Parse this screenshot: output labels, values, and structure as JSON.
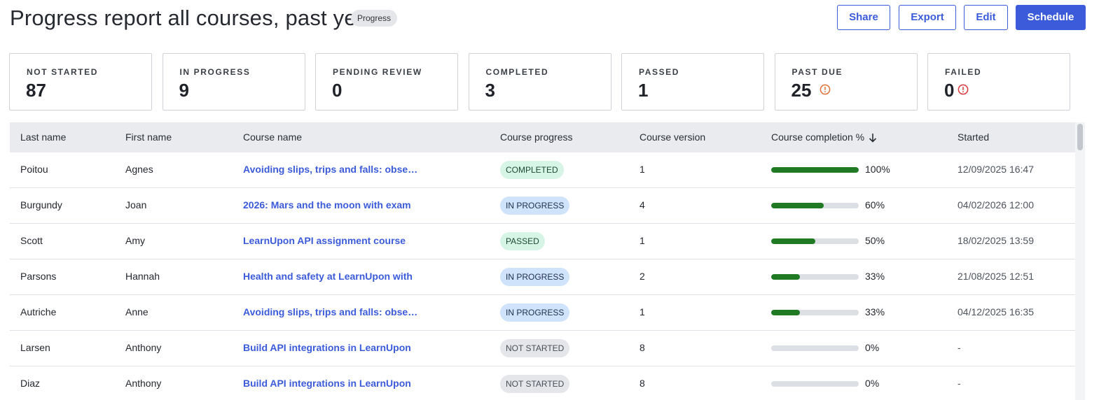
{
  "header": {
    "title": "Progress report all courses, past year",
    "report_type": "Progress",
    "actions": {
      "share": "Share",
      "export": "Export",
      "edit": "Edit",
      "schedule": "Schedule"
    }
  },
  "colors": {
    "accent": "#3b5bdb",
    "progress_fill": "#1f7a23",
    "warning": "#e0703a",
    "danger": "#d9363e"
  },
  "stats": [
    {
      "label": "NOT STARTED",
      "value": "87"
    },
    {
      "label": "IN PROGRESS",
      "value": "9"
    },
    {
      "label": "PENDING REVIEW",
      "value": "0"
    },
    {
      "label": "COMPLETED",
      "value": "3"
    },
    {
      "label": "PASSED",
      "value": "1"
    },
    {
      "label": "PAST DUE",
      "value": "25",
      "icon": "warning-circle-icon"
    },
    {
      "label": "FAILED",
      "value": "0",
      "icon": "error-circle-icon"
    }
  ],
  "table": {
    "columns": [
      "Last name",
      "First name",
      "Course name",
      "Course progress",
      "Course version",
      "Course completion %",
      "Started"
    ],
    "sort": {
      "column": "Course completion %",
      "direction": "descending",
      "icon": "arrow-down-icon"
    },
    "rows": [
      {
        "last": "Poitou",
        "first": "Agnes",
        "course": "Avoiding slips, trips and falls: observe",
        "status": "COMPLETED",
        "status_key": "completed",
        "version": "1",
        "completion": 100,
        "completion_label": "100%",
        "started": "12/09/2025 16:47"
      },
      {
        "last": "Burgundy",
        "first": "Joan",
        "course": "2026: Mars and the moon with exam",
        "status": "IN PROGRESS",
        "status_key": "in-progress",
        "version": "4",
        "completion": 60,
        "completion_label": "60%",
        "started": "04/02/2026 12:00"
      },
      {
        "last": "Scott",
        "first": "Amy",
        "course": "LearnUpon API assignment course",
        "status": "PASSED",
        "status_key": "passed",
        "version": "1",
        "completion": 50,
        "completion_label": "50%",
        "started": "18/02/2025 13:59"
      },
      {
        "last": "Parsons",
        "first": "Hannah",
        "course": "Health and safety at LearnUpon with",
        "status": "IN PROGRESS",
        "status_key": "in-progress",
        "version": "2",
        "completion": 33,
        "completion_label": "33%",
        "started": "21/08/2025 12:51"
      },
      {
        "last": "Autriche",
        "first": "Anne",
        "course": "Avoiding slips, trips and falls: observe",
        "status": "IN PROGRESS",
        "status_key": "in-progress",
        "version": "1",
        "completion": 33,
        "completion_label": "33%",
        "started": "04/12/2025 16:35"
      },
      {
        "last": "Larsen",
        "first": "Anthony",
        "course": "Build API integrations in LearnUpon",
        "status": "NOT STARTED",
        "status_key": "not-started",
        "version": "8",
        "completion": 0,
        "completion_label": "0%",
        "started": "-"
      },
      {
        "last": "Diaz",
        "first": "Anthony",
        "course": "Build API integrations in LearnUpon",
        "status": "NOT STARTED",
        "status_key": "not-started",
        "version": "8",
        "completion": 0,
        "completion_label": "0%",
        "started": "-"
      }
    ]
  }
}
